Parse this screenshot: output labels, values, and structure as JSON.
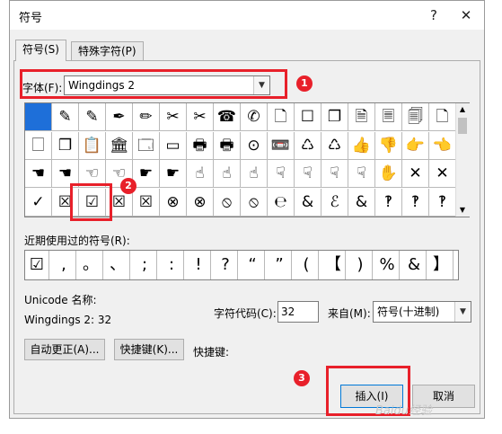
{
  "window": {
    "title": "符号",
    "help_glyph": "?",
    "close_glyph": "✕"
  },
  "tabs": [
    {
      "label": "符号(S)"
    },
    {
      "label": "特殊字符(P)"
    }
  ],
  "font": {
    "label": "字体(F):",
    "value": "Wingdings 2"
  },
  "symbol_grid": {
    "rows": [
      [
        "",
        "✎",
        "✎",
        "✒",
        "✏",
        "✂",
        "✂",
        "☎",
        "✆",
        "🗋",
        "☐",
        "❐",
        "🗎",
        "🗏",
        "🗐",
        "🗋"
      ],
      [
        "🗌",
        "❐",
        "📋",
        "🏛",
        "🗔",
        "▭",
        "🖶",
        "🖶",
        "⊙",
        "📼",
        "♺",
        "♺",
        "👍",
        "👎",
        "👉",
        "👈"
      ],
      [
        "☚",
        "☚",
        "☜",
        "☜",
        "☛",
        "☛",
        "☝",
        "☝",
        "☝",
        "☟",
        "☟",
        "☟",
        "☟",
        "✋",
        "✕",
        "✕"
      ],
      [
        "✓",
        "☒",
        "☑",
        "☒",
        "☒",
        "⊗",
        "⊗",
        "⦸",
        "⦸",
        "℮",
        "&",
        "ℰ",
        "&",
        "‽",
        "‽",
        "‽"
      ]
    ]
  },
  "recent": {
    "label": "近期使用过的符号(R):",
    "symbols": [
      "☑",
      ",",
      "。",
      "、",
      ";",
      ":",
      "!",
      "?",
      "“",
      "”",
      "(",
      "【",
      ")",
      "%",
      "&",
      "】"
    ]
  },
  "unicode_name": {
    "label": "Unicode 名称:",
    "value": "Wingdings 2: 32"
  },
  "char_code": {
    "label": "字符代码(C):",
    "value": "32"
  },
  "from": {
    "label": "来自(M):",
    "value": "符号(十进制)"
  },
  "buttons": {
    "autocorrect": "自动更正(A)...",
    "shortcut_key": "快捷键(K)...",
    "shortcut_label": "快捷键:",
    "insert": "插入(I)",
    "cancel": "取消"
  },
  "annotations": [
    "1",
    "2",
    "3"
  ],
  "watermark": "Baidu经验",
  "colors": {
    "highlight": "#e8202a",
    "selected_cell": "#1e6fd9"
  }
}
